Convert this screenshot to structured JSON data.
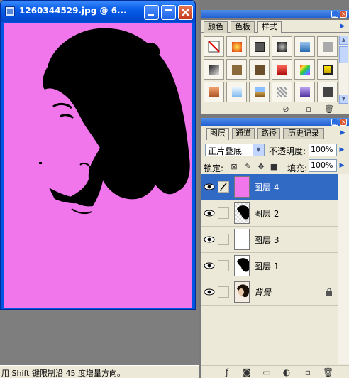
{
  "document": {
    "title": "1260344529.jpg @ 6...",
    "canvas_color": "#f176ec"
  },
  "statusbar": {
    "text": "用 Shift 键限制沿 45 度增量方向。"
  },
  "styles_panel": {
    "tabs": [
      "颜色",
      "色板",
      "样式"
    ],
    "active_tab": "样式",
    "swatch_icons": [
      "no-style-icon",
      "fire-glow-icon",
      "gray-bevel-icon",
      "dark-button-icon",
      "blue-glass-icon",
      "gray-plain-icon",
      "gradient-gray-icon",
      "bronze-icon",
      "brown-texture-icon",
      "red-plastic-icon",
      "rainbow-icon",
      "yellow-black-icon",
      "sunset-icon",
      "sky-blue-icon",
      "landscape-icon",
      "pattern-icon",
      "purple-glass-icon",
      "dark-gray-icon"
    ]
  },
  "layers_panel": {
    "tabs": [
      "图层",
      "通道",
      "路径",
      "历史记录"
    ],
    "active_tab": "图层",
    "blend_mode": "正片叠底",
    "opacity_label": "不透明度:",
    "opacity_value": "100%",
    "lock_label": "锁定:",
    "fill_label": "填充:",
    "fill_value": "100%",
    "layers": [
      {
        "name": "图层 4",
        "selected": true,
        "thumb": "pink",
        "brush": true
      },
      {
        "name": "图层 2",
        "selected": false,
        "thumb": "silhouette"
      },
      {
        "name": "图层 3",
        "selected": false,
        "thumb": "white"
      },
      {
        "name": "图层 1",
        "selected": false,
        "thumb": "silhouette"
      },
      {
        "name": "背景",
        "selected": false,
        "thumb": "photo",
        "locked": true
      }
    ]
  },
  "colors": {
    "selection": "#316ac5",
    "title_blue": "#0054e3",
    "panel_bg": "#ece9d8"
  }
}
